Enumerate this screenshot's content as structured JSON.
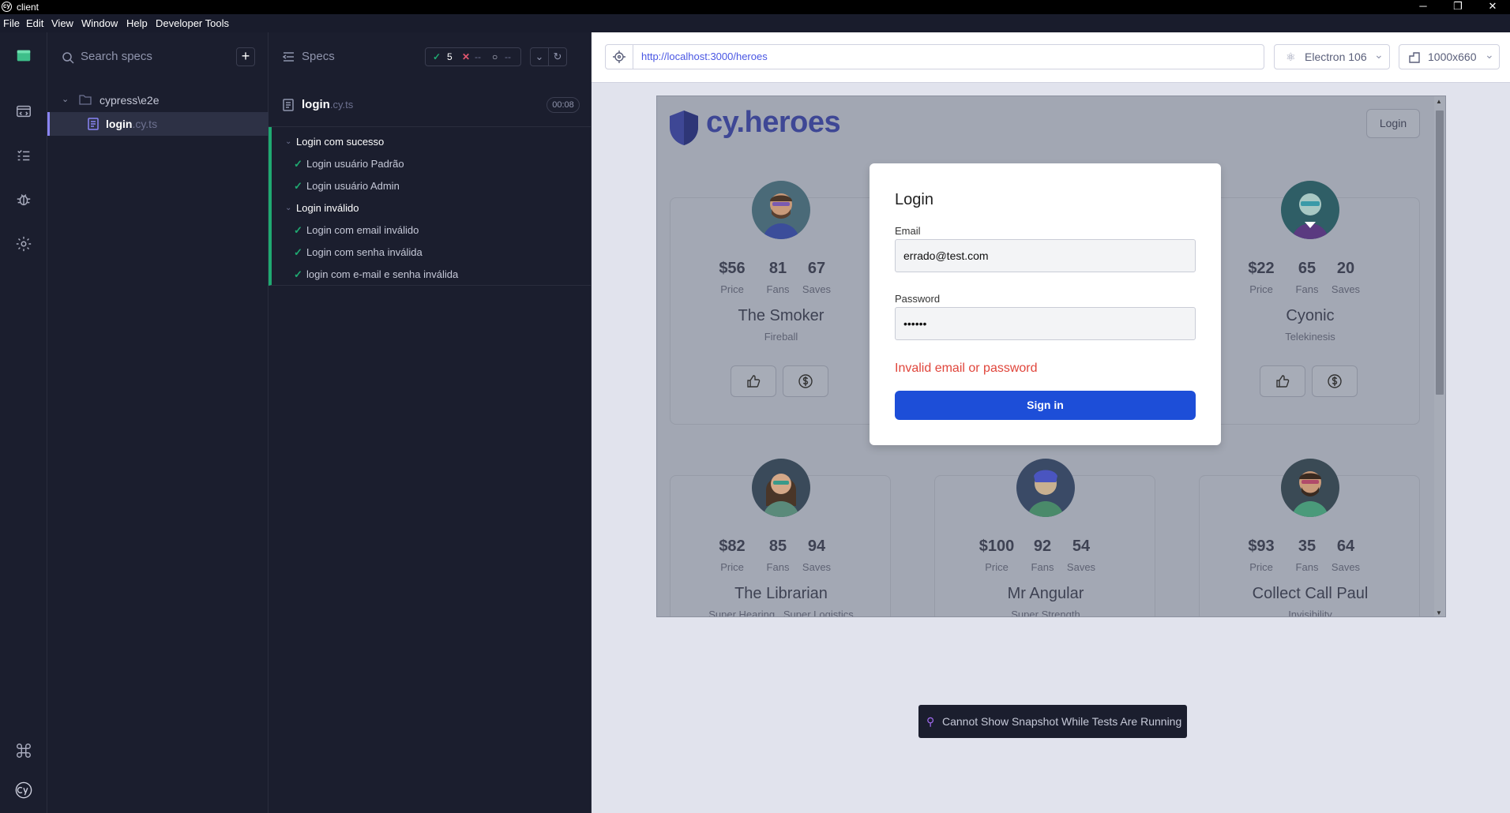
{
  "window": {
    "title": "client",
    "minimize": "─",
    "maximize": "❐",
    "close": "✕"
  },
  "menu": {
    "items": [
      "File",
      "Edit",
      "View",
      "Window",
      "Help",
      "Developer Tools"
    ]
  },
  "spec_list": {
    "search_placeholder": "Search specs",
    "add_label": "+",
    "folder": "cypress\\e2e",
    "file": {
      "name": "login",
      "ext": ".cy.ts"
    }
  },
  "reporter": {
    "header": "Specs",
    "stats": {
      "passed": "5",
      "failed": "--",
      "pending": "--"
    },
    "spec": {
      "name": "login",
      "ext": ".cy.ts",
      "duration": "00:08"
    },
    "suites": [
      {
        "title": "Login com sucesso",
        "tests": [
          "Login usuário Padrão",
          "Login usuário Admin"
        ]
      },
      {
        "title": "Login inválido",
        "tests": [
          "Login com email inválido",
          "Login com senha inválida",
          "login com e-mail e senha inválida"
        ]
      }
    ]
  },
  "aut": {
    "url": "http://localhost:3000/heroes",
    "browser": "Electron 106",
    "viewport": "1000x660",
    "snapshot_message": "Cannot Show Snapshot While Tests Are Running"
  },
  "app": {
    "logo": "cy.heroes",
    "login_button": "Login",
    "stat_labels": {
      "price": "Price",
      "fans": "Fans",
      "saves": "Saves"
    },
    "heroes": [
      {
        "name": "The Smoker",
        "power": "Fireball",
        "price": "$56",
        "fans": "81",
        "saves": "67"
      },
      {
        "name": "Cyonic",
        "power": "Telekinesis",
        "price": "$22",
        "fans": "65",
        "saves": "20"
      },
      {
        "name": "The Librarian",
        "power": "Super Hearing , Super Logistics",
        "price": "$82",
        "fans": "85",
        "saves": "94"
      },
      {
        "name": "Mr Angular",
        "power": "Super Strength",
        "price": "$100",
        "fans": "92",
        "saves": "54"
      },
      {
        "name": "Collect Call Paul",
        "power": "Invisibility",
        "price": "$93",
        "fans": "35",
        "saves": "64"
      }
    ]
  },
  "modal": {
    "title": "Login",
    "email_label": "Email",
    "email_value": "errado@test.com",
    "password_label": "Password",
    "password_value": "••••••",
    "error": "Invalid email or password",
    "submit": "Sign in"
  }
}
